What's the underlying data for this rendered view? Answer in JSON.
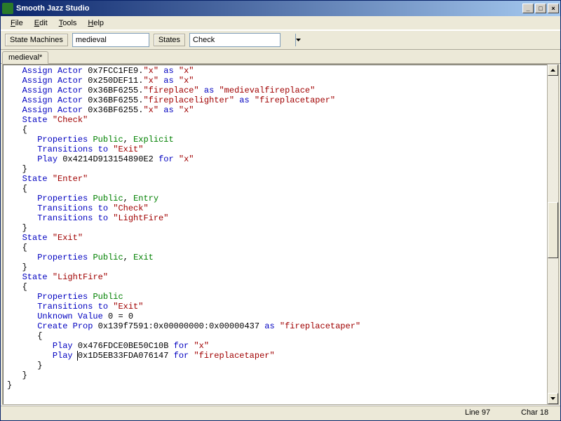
{
  "window": {
    "title": "Smooth Jazz Studio"
  },
  "menu": {
    "file": "File",
    "edit": "Edit",
    "tools": "Tools",
    "help": "Help"
  },
  "toolbar": {
    "sm_label": "State Machines",
    "sm_value": "medieval",
    "states_label": "States",
    "states_value": "Check"
  },
  "tab": {
    "label": "medieval*"
  },
  "status": {
    "line_label": "Line",
    "line_val": "97",
    "char_label": "Char",
    "char_val": "18"
  },
  "code": {
    "l1_a": "Assign Actor",
    "l1_h": "0x7FCC1FE9",
    "l1_m": ".",
    "l1_q1": "\"x\"",
    "l1_as": "as",
    "l1_q2": "\"x\"",
    "l2_h": "0x250DEF11",
    "l2_q1": "\"x\"",
    "l2_q2": "\"x\"",
    "l3_h": "0x36BF6255",
    "l3_m": "\"fireplace\"",
    "l3_q2": "\"medievalfireplace\"",
    "l4_m": "\"fireplacelighter\"",
    "l4_q2": "\"fireplacetaper\"",
    "l5_q1": "\"x\"",
    "l5_q2": "\"x\"",
    "state": "State",
    "check": "\"Check\"",
    "enter": "\"Enter\"",
    "exit": "\"Exit\"",
    "lightfire": "\"LightFire\"",
    "props": "Properties",
    "public": "Public",
    "explicit": "Explicit",
    "entry": "Entry",
    "exitk": "Exit",
    "trans": "Transitions",
    "to": "to",
    "play": "Play",
    "for": "for",
    "ph1": "0x4214D913154890E2",
    "px": "\"x\"",
    "create": "Create Prop",
    "ch": "0x139f7591:0x00000000:0x00000437",
    "cpq": "\"fireplacetaper\"",
    "unk": "Unknown Value",
    "unk0": "0 = 0",
    "ph2": "0x476FDCE0BE50C10B",
    "ph3": "0x1D5EB33FDA076147",
    "pq2": "\"fireplacetaper\""
  }
}
